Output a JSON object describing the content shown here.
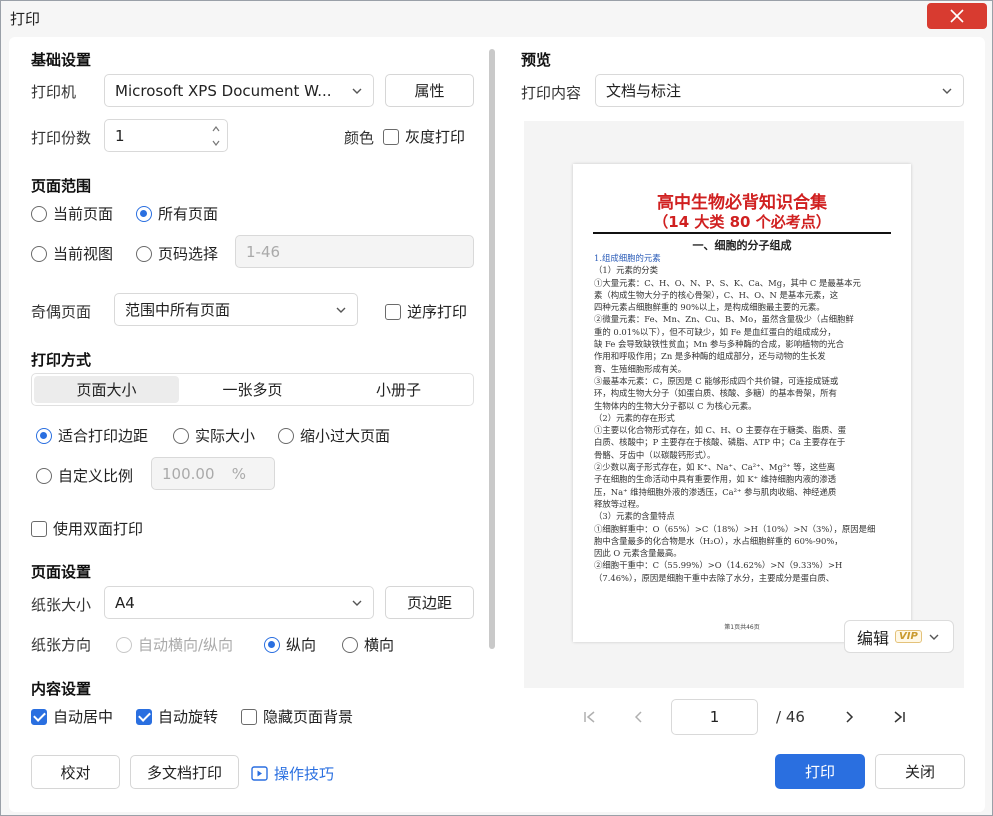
{
  "window": {
    "title": "打印",
    "close_icon": "close-icon"
  },
  "basic": {
    "section": "基础设置",
    "printer_label": "打印机",
    "printer_value": "Microsoft XPS Document W...",
    "properties_button": "属性",
    "copies_label": "打印份数",
    "copies_value": "1",
    "color_label": "颜色",
    "grayscale_label": "灰度打印"
  },
  "range": {
    "section": "页面范围",
    "current_page": "当前页面",
    "all_pages": "所有页面",
    "current_view": "当前视图",
    "page_select": "页码选择",
    "page_select_placeholder": "1-46",
    "odd_even_label": "奇偶页面",
    "odd_even_value": "范围中所有页面",
    "reverse_label": "逆序打印"
  },
  "mode": {
    "section": "打印方式",
    "tabs": [
      "页面大小",
      "一张多页",
      "小册子"
    ],
    "fit_margins": "适合打印边距",
    "actual_size": "实际大小",
    "shrink_large": "缩小过大页面",
    "custom_scale": "自定义比例",
    "scale_value": "100.00",
    "scale_unit": "%",
    "duplex_label": "使用双面打印"
  },
  "page_setup": {
    "section": "页面设置",
    "paper_label": "纸张大小",
    "paper_value": "A4",
    "margins_button": "页边距",
    "orientation_label": "纸张方向",
    "auto_orientation": "自动横向/纵向",
    "portrait": "纵向",
    "landscape": "横向"
  },
  "content": {
    "section": "内容设置",
    "auto_center": "自动居中",
    "auto_rotate": "自动旋转",
    "hide_background": "隐藏页面背景"
  },
  "footer": {
    "proof_button": "校对",
    "multi_doc_button": "多文档打印",
    "tips_link": "操作技巧",
    "print_button": "打印",
    "close_button": "关闭"
  },
  "preview": {
    "section": "预览",
    "content_label": "打印内容",
    "content_value": "文档与标注",
    "edit_button": "编辑",
    "vip_badge": "VIP",
    "current_page": "1",
    "total_pages": "/ 46"
  },
  "doc": {
    "title": "高中生物必背知识合集",
    "subtitle": "（14 大类 80 个必考点）",
    "heading": "一、细胞的分子组成",
    "lines": [
      "1.组成细胞的元素",
      "（1）元素的分类",
      "①大量元素：C、H、O、N、P、S、K、Ca、Mg，其中 C 是最基本元",
      "素（构成生物大分子的核心骨架），C、H、O、N 是基本元素，这",
      "四种元素占细胞鲜重的 90%以上，是构成细胞最主要的元素。",
      "②微量元素：Fe、Mn、Zn、Cu、B、Mo，虽然含量极少（占细胞鲜",
      "重的 0.01%以下），但不可缺少，如 Fe 是血红蛋白的组成成分，",
      "缺 Fe 会导致缺铁性贫血；Mn 参与多种酶的合成，影响植物的光合",
      "作用和呼吸作用；Zn 是多种酶的组成部分，还与动物的生长发",
      "育、生殖细胞形成有关。",
      "③最基本元素：C，原因是 C 能够形成四个共价键，可连接成链或",
      "环，构成生物大分子（如蛋白质、核酸、多糖）的基本骨架，所有",
      "生物体内的生物大分子都以 C 为核心元素。",
      "（2）元素的存在形式",
      "①主要以化合物形式存在，如 C、H、O 主要存在于糖类、脂质、蛋",
      "白质、核酸中；P 主要存在于核酸、磷脂、ATP 中；Ca 主要存在于",
      "骨骼、牙齿中（以碳酸钙形式）。",
      "②少数以离子形式存在，如 K⁺、Na⁺、Ca²⁺、Mg²⁺ 等，这些离",
      "子在细胞的生命活动中具有重要作用，如 K⁺ 维持细胞内液的渗透",
      "压，Na⁺ 维持细胞外液的渗透压，Ca²⁺ 参与肌肉收缩、神经递质",
      "释放等过程。",
      "（3）元素的含量特点",
      "①细胞鲜重中：O（65%）>C（18%）>H（10%）>N（3%），原因是细",
      "胞中含量最多的化合物是水（H₂O），水占细胞鲜重的 60%-90%，",
      "因此 O 元素含量最高。",
      "②细胞干重中：C（55.99%）>O（14.62%）>N（9.33%）>H",
      "（7.46%），原因是细胞干重中去除了水分，主要成分是蛋白质、"
    ],
    "footer": "第1页共46页"
  },
  "colors": {
    "accent": "#2a6fe0",
    "close": "#d83b30",
    "doc_red": "#d02020"
  }
}
